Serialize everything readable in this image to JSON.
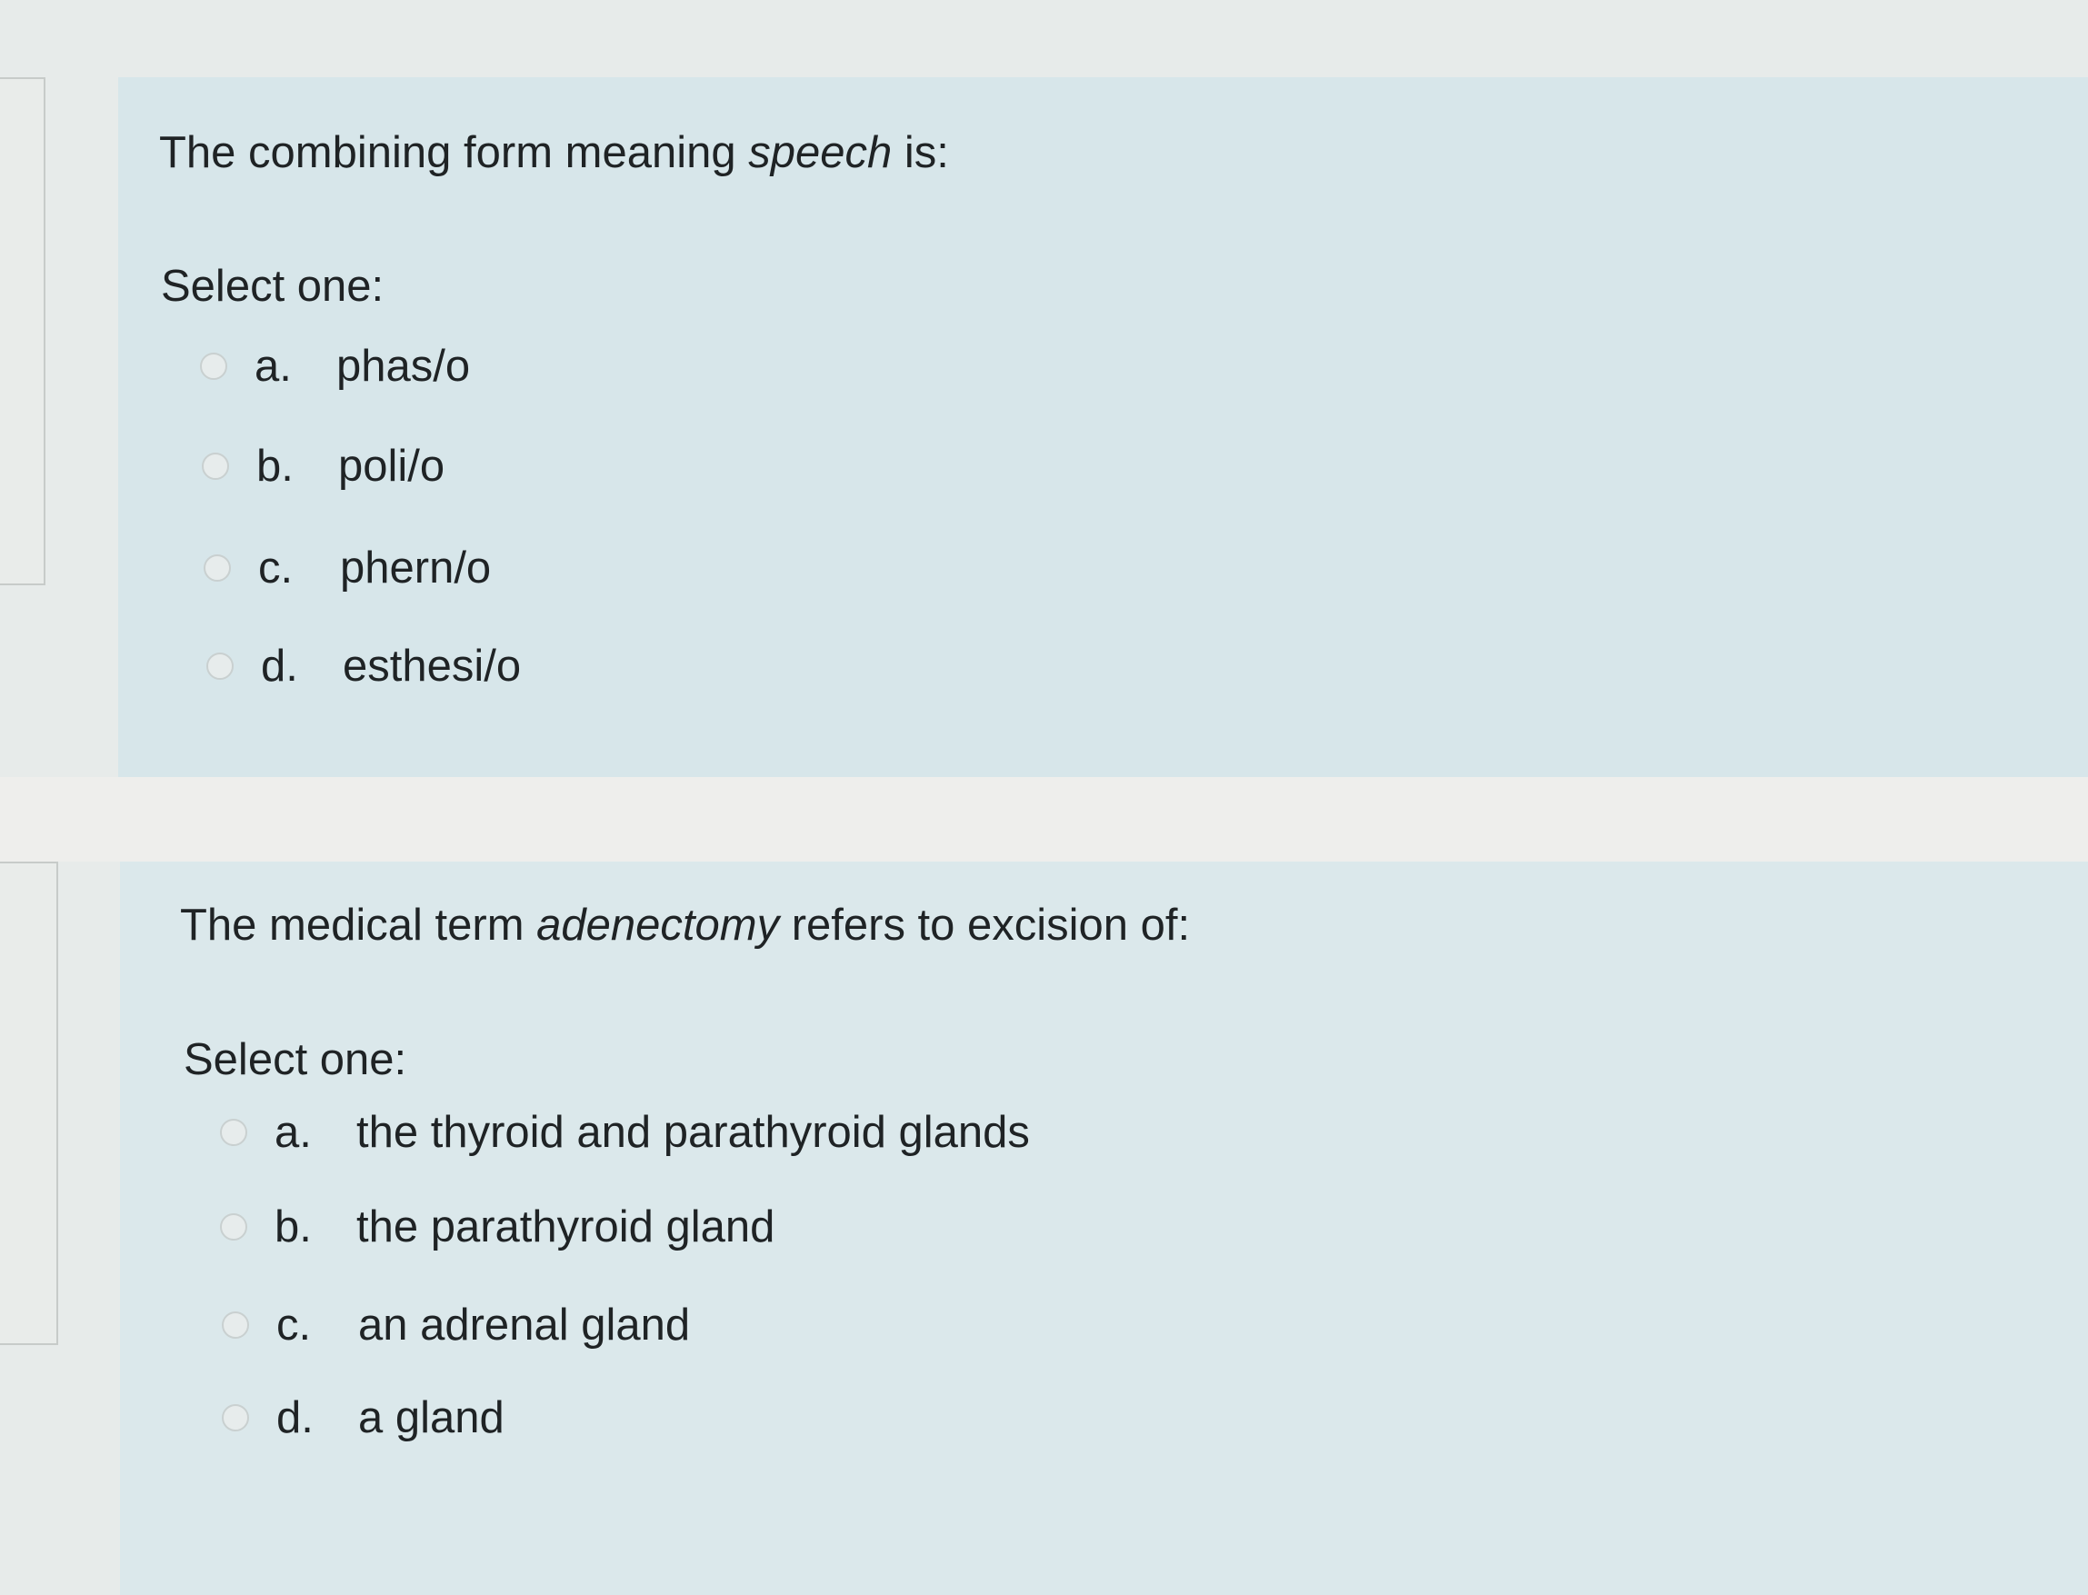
{
  "questions": [
    {
      "prompt_before": "The combining form meaning ",
      "prompt_emphasis": "speech",
      "prompt_after": " is:",
      "select_label": "Select one:",
      "options": [
        {
          "letter": "a.",
          "text": "phas/o"
        },
        {
          "letter": "b.",
          "text": "poli/o"
        },
        {
          "letter": "c.",
          "text": "phern/o"
        },
        {
          "letter": "d.",
          "text": "esthesi/o"
        }
      ]
    },
    {
      "prompt_before": "The medical term ",
      "prompt_emphasis": "adenectomy",
      "prompt_after": " refers to excision of:",
      "select_label": "Select one:",
      "options": [
        {
          "letter": "a.",
          "text": "the thyroid and parathyroid glands"
        },
        {
          "letter": "b.",
          "text": "the parathyroid gland"
        },
        {
          "letter": "c.",
          "text": "an adrenal gland"
        },
        {
          "letter": "d.",
          "text": "a gland"
        }
      ]
    }
  ]
}
